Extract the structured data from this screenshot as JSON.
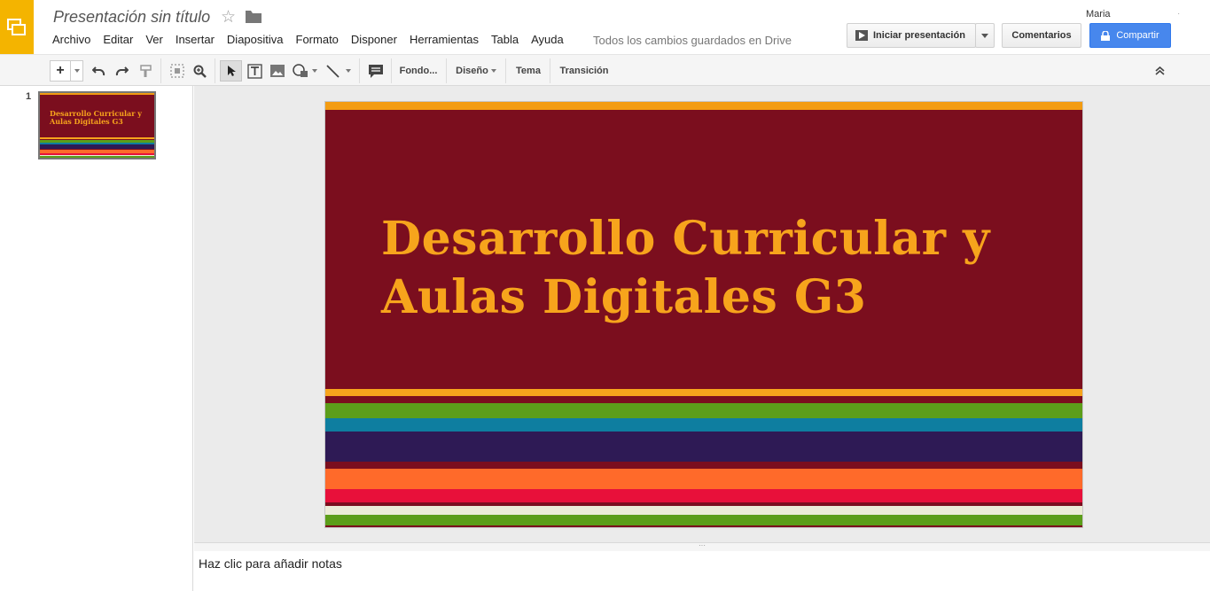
{
  "header": {
    "title": "Presentación sin título",
    "save_status": "Todos los cambios guardados en Drive",
    "user_name": "Maria",
    "present_label": "Iniciar presentación",
    "comments_label": "Comentarios",
    "share_label": "Compartir",
    "menu": [
      "Archivo",
      "Editar",
      "Ver",
      "Insertar",
      "Diapositiva",
      "Formato",
      "Disponer",
      "Herramientas",
      "Tabla",
      "Ayuda"
    ]
  },
  "toolbar": {
    "background_label": "Fondo...",
    "layout_label": "Diseño",
    "theme_label": "Tema",
    "transition_label": "Transición"
  },
  "filmstrip": {
    "slide_number": "1",
    "thumb_title": "Desarrollo Curricular y Aulas Digitales G3"
  },
  "slide": {
    "title": "Desarrollo Curricular y Aulas Digitales G3"
  },
  "notes": {
    "placeholder": "Haz clic para añadir notas"
  },
  "colors": {
    "brand": "#f4b400",
    "share": "#4787ed",
    "slide_bg": "#7b0e1e",
    "slide_title": "#f7a41c"
  }
}
